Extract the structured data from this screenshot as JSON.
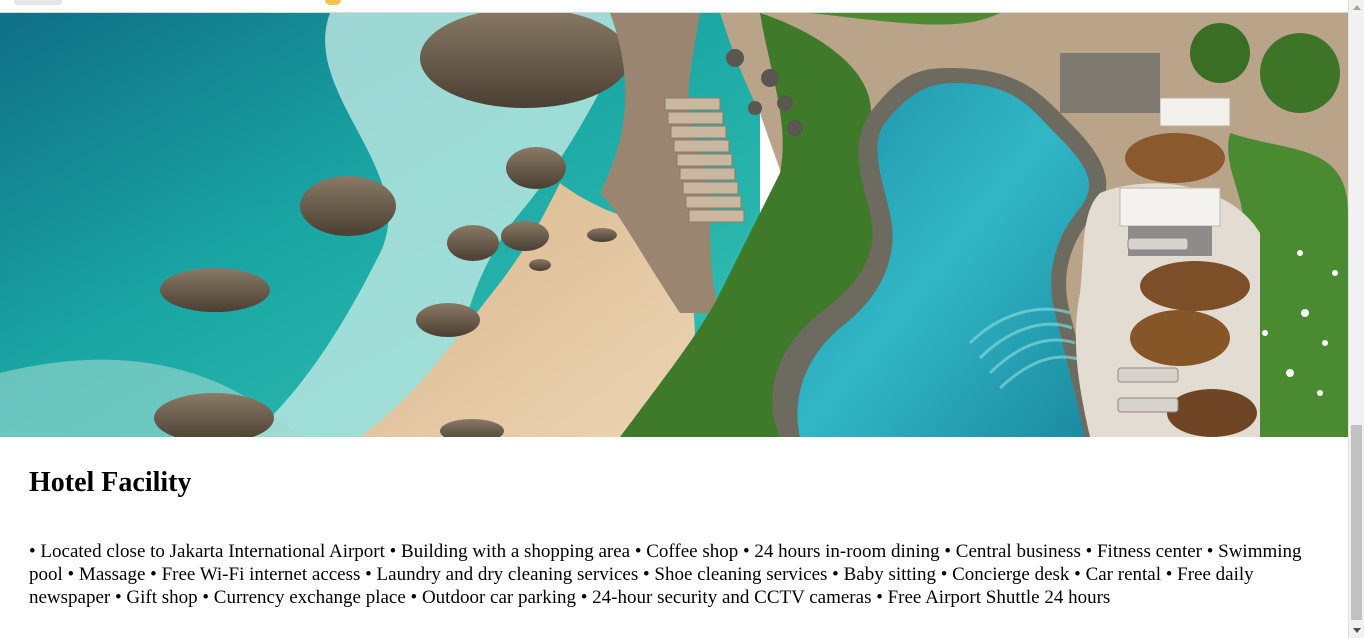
{
  "hero_image": {
    "icon": "resort-cliff-pool-beach-photo"
  },
  "facility": {
    "heading": "Hotel Facility",
    "description": "• Located close to Jakarta International Airport • Building with a shopping area • Coffee shop • 24 hours in-room dining • Central business • Fitness center • Swimming pool • Massage • Free Wi-Fi internet access • Laundry and dry cleaning services • Shoe cleaning services • Baby sitting • Concierge desk • Car rental • Free daily newspaper • Gift shop • Currency exchange place • Outdoor car parking • 24-hour security and CCTV cameras • Free Airport Shuttle 24 hours"
  },
  "scrollbar": {
    "position_fraction": 0.72
  },
  "colors": {
    "sea": "#1aa6a0",
    "sand": "#e4c9a3",
    "pool": "#2fb3c4",
    "foliage": "#3f7a2a"
  }
}
